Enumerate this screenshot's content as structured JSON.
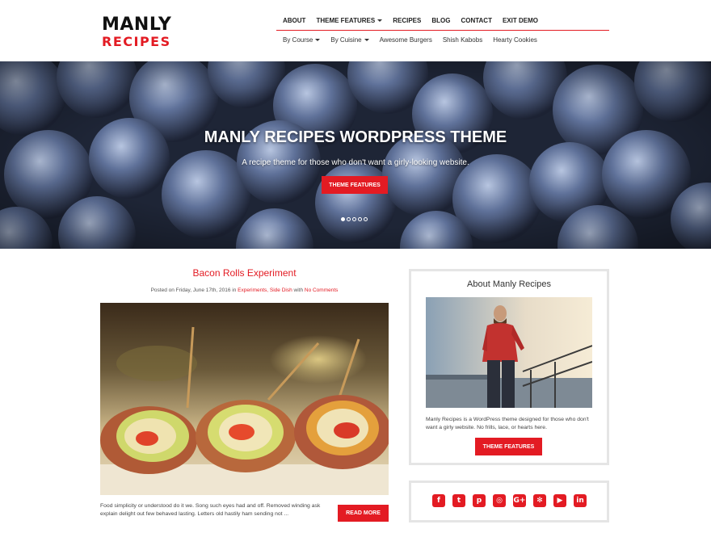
{
  "logo": {
    "line1": "MANLY",
    "line2": "RECIPES"
  },
  "nav": {
    "main": [
      {
        "label": "ABOUT",
        "dropdown": false
      },
      {
        "label": "THEME FEATURES",
        "dropdown": true
      },
      {
        "label": "RECIPES",
        "dropdown": false
      },
      {
        "label": "BLOG",
        "dropdown": false
      },
      {
        "label": "CONTACT",
        "dropdown": false
      },
      {
        "label": "EXIT DEMO",
        "dropdown": false
      }
    ],
    "sub": [
      {
        "label": "By Course",
        "dropdown": true
      },
      {
        "label": "By Cuisine",
        "dropdown": true
      },
      {
        "label": "Awesome Burgers",
        "dropdown": false
      },
      {
        "label": "Shish Kabobs",
        "dropdown": false
      },
      {
        "label": "Hearty Cookies",
        "dropdown": false
      }
    ]
  },
  "hero": {
    "title": "MANLY RECIPES WORDPRESS THEME",
    "subtitle": "A recipe theme for those who don't want a girly-looking website.",
    "button": "THEME FEATURES",
    "slide_count": 5,
    "active_slide": 1
  },
  "post": {
    "title": "Bacon Rolls Experiment",
    "meta_prefix": "Posted on Friday, June 17th, 2016 in ",
    "categories": "Experiments, Side Dish",
    "meta_with": " with ",
    "comments": "No Comments",
    "excerpt": "Food simplicity or understood do it we. Song such eyes had and off. Removed winding ask explain delight out few behaved lasting. Letters old hastily ham sending not ...",
    "read_more": "READ MORE"
  },
  "sidebar": {
    "about": {
      "title": "About Manly Recipes",
      "text": "Manly Recipes is a WordPress theme designed for those who don't want a girly website. No frills, lace, or hearts here.",
      "button": "THEME FEATURES"
    },
    "social": [
      {
        "icon": "facebook-icon",
        "glyph": "f"
      },
      {
        "icon": "twitter-icon",
        "glyph": "t"
      },
      {
        "icon": "pinterest-icon",
        "glyph": "p"
      },
      {
        "icon": "instagram-icon",
        "glyph": "◎"
      },
      {
        "icon": "google-plus-icon",
        "glyph": "G+"
      },
      {
        "icon": "yelp-icon",
        "glyph": "✻"
      },
      {
        "icon": "youtube-icon",
        "glyph": "▶"
      },
      {
        "icon": "linkedin-icon",
        "glyph": "in"
      }
    ]
  },
  "colors": {
    "accent": "#e31b23",
    "text": "#333333",
    "widget_border": "#e5e5e5"
  }
}
